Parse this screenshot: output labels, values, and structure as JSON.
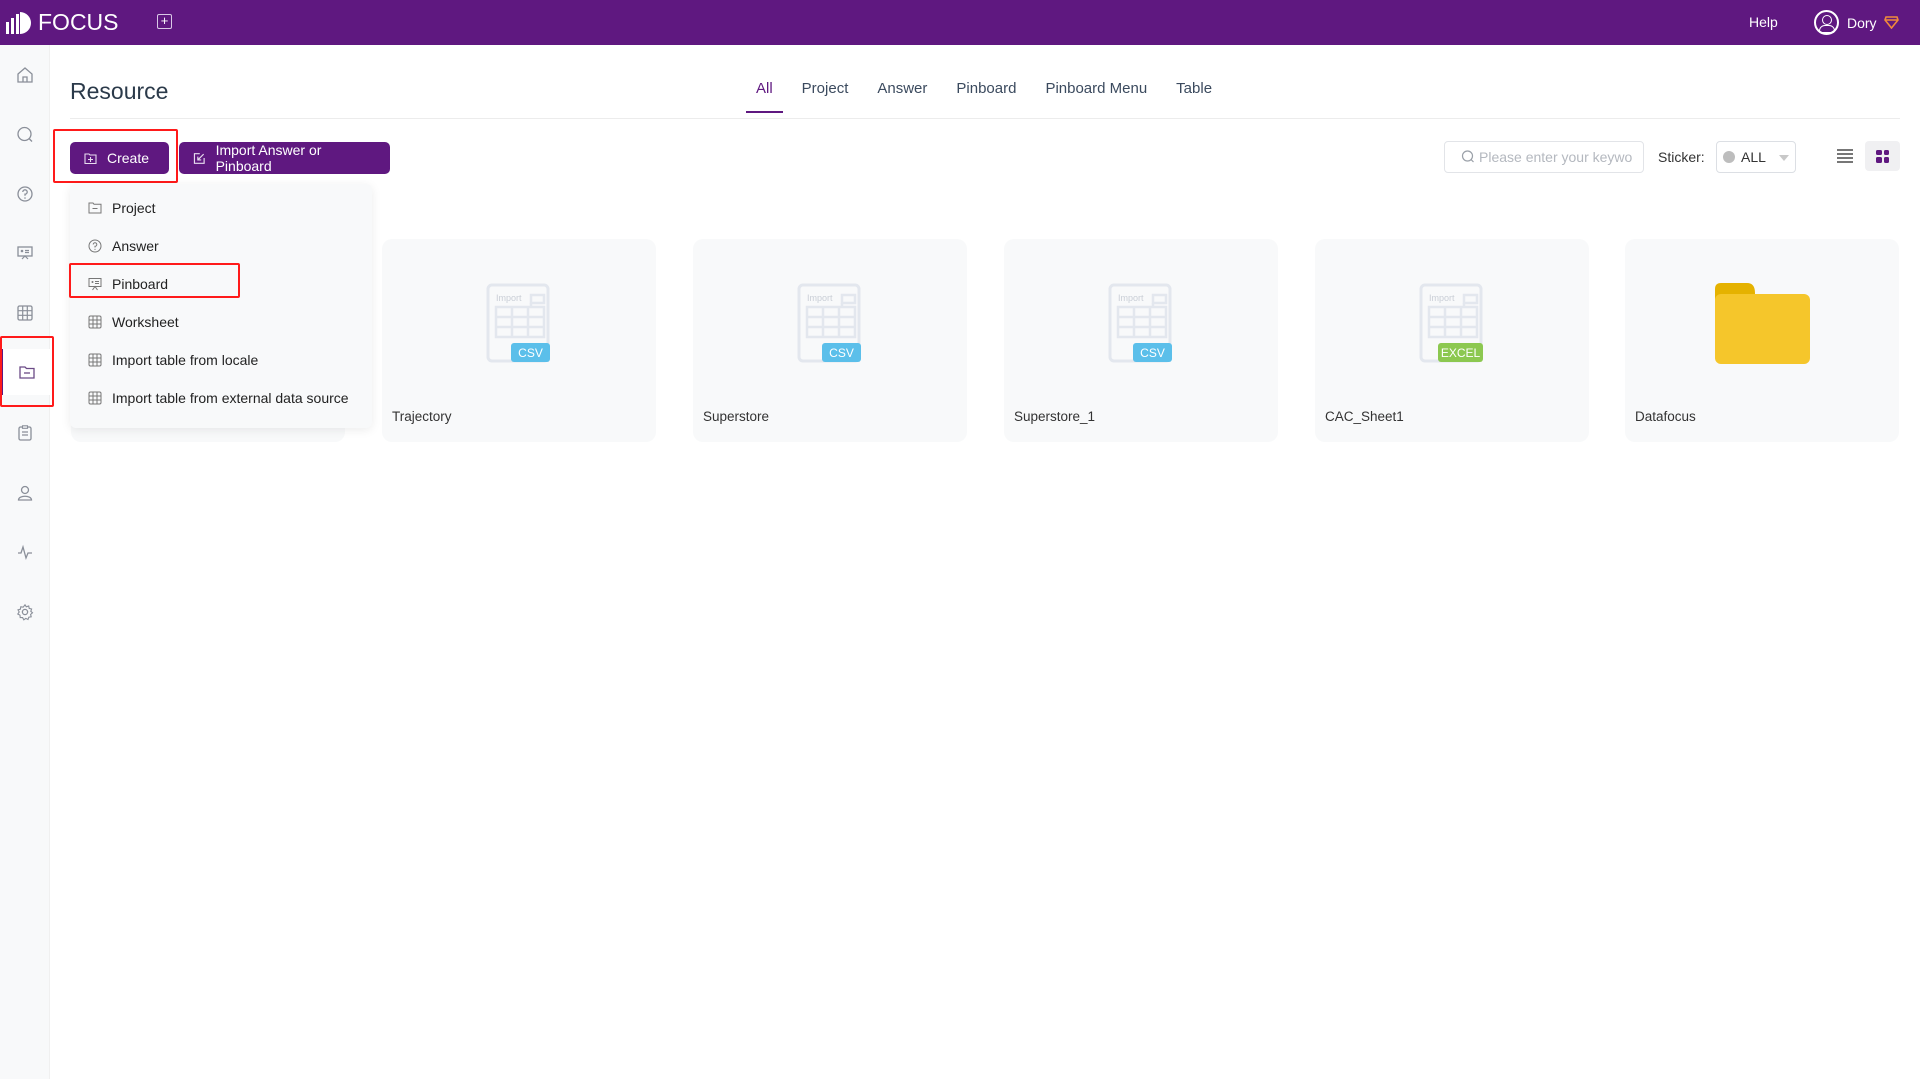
{
  "app": {
    "logo_text": "FOCUS",
    "help_label": "Help",
    "user_name": "Dory",
    "brand_color": "#5f1880"
  },
  "sidebar": {
    "items": [
      {
        "id": "home",
        "icon": "home-icon",
        "active": false
      },
      {
        "id": "search",
        "icon": "search-icon",
        "active": false
      },
      {
        "id": "answer",
        "icon": "question-circle-icon",
        "active": false
      },
      {
        "id": "pinboard",
        "icon": "presentation-board-icon",
        "active": false
      },
      {
        "id": "data",
        "icon": "table-grid-icon",
        "active": false
      },
      {
        "id": "resource",
        "icon": "folder-icon",
        "active": true
      },
      {
        "id": "tasks",
        "icon": "clipboard-icon",
        "active": false
      },
      {
        "id": "users",
        "icon": "user-icon",
        "active": false
      },
      {
        "id": "monitor",
        "icon": "pulse-icon",
        "active": false
      },
      {
        "id": "settings",
        "icon": "gear-icon",
        "active": false
      }
    ]
  },
  "main": {
    "title": "Resource",
    "tabs": [
      {
        "label": "All",
        "active": true
      },
      {
        "label": "Project",
        "active": false
      },
      {
        "label": "Answer",
        "active": false
      },
      {
        "label": "Pinboard",
        "active": false
      },
      {
        "label": "Pinboard Menu",
        "active": false
      },
      {
        "label": "Table",
        "active": false
      }
    ],
    "toolbar": {
      "create_label": "Create",
      "import_label": "Import Answer or Pinboard",
      "search_placeholder": "Please enter your keywo",
      "sticker_label": "Sticker:",
      "sticker_value": "ALL",
      "view_mode": "grid"
    },
    "create_menu": {
      "items": [
        {
          "label": "Project",
          "icon": "folder-icon"
        },
        {
          "label": "Answer",
          "icon": "question-circle-icon"
        },
        {
          "label": "Pinboard",
          "icon": "presentation-board-icon",
          "highlighted": true
        },
        {
          "label": "Worksheet",
          "icon": "table-grid-icon"
        },
        {
          "label": "Import table from locale",
          "icon": "table-grid-icon"
        },
        {
          "label": "Import table from external data source",
          "icon": "table-grid-icon"
        }
      ]
    },
    "cards": [
      {
        "name": "",
        "type": "hidden"
      },
      {
        "name": "Trajectory",
        "type": "csv",
        "badge": "CSV",
        "icon_text": "Import"
      },
      {
        "name": "Superstore",
        "type": "csv",
        "badge": "CSV",
        "icon_text": "Import"
      },
      {
        "name": "Superstore_1",
        "type": "csv",
        "badge": "CSV",
        "icon_text": "Import"
      },
      {
        "name": "CAC_Sheet1",
        "type": "excel",
        "badge": "EXCEL",
        "icon_text": "Import"
      },
      {
        "name": "Datafocus",
        "type": "folder"
      }
    ],
    "badge_colors": {
      "csv": "#5bbfea",
      "excel": "#8cc850",
      "folder": "#f5c62b",
      "folder_tab": "#e5b200"
    }
  }
}
